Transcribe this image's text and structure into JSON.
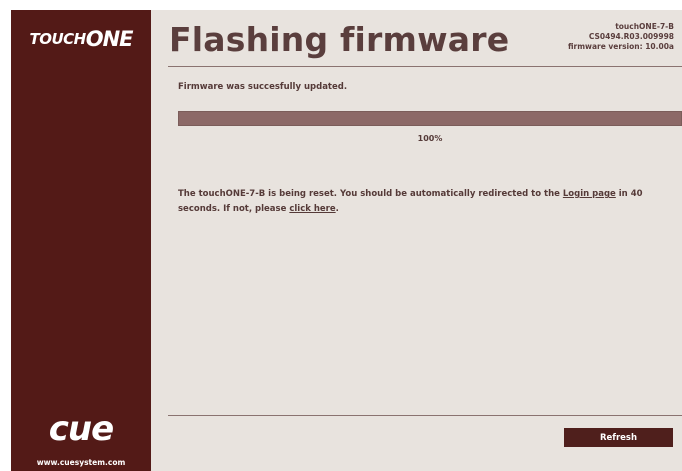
{
  "brand": {
    "prefix": "TOUCH",
    "suffix": "ONE",
    "company_logo": "cue",
    "company_url": "www.cuesystem.com"
  },
  "header": {
    "title": "Flashing firmware",
    "device_name": "touchONE-7-B",
    "device_id": "CS0494.R03.009998",
    "firmware_version": "firmware version: 10.00a"
  },
  "status": {
    "message": "Firmware was succesfully updated.",
    "progress": 1.0,
    "progress_label": "100%"
  },
  "reset": {
    "text_before": "The touchONE-7-B is being reset. You should be automatically redirected to the ",
    "login_link": "Login page",
    "text_middle": " in 40 seconds. If not, please ",
    "click_link": "click here",
    "text_after": "."
  },
  "actions": {
    "refresh_label": "Refresh"
  },
  "colors": {
    "sidebar": "#531a17",
    "content_bg": "#e8e3de",
    "text": "#553a38",
    "progress_fill": "#8c6967",
    "button": "#4f1f1c"
  }
}
